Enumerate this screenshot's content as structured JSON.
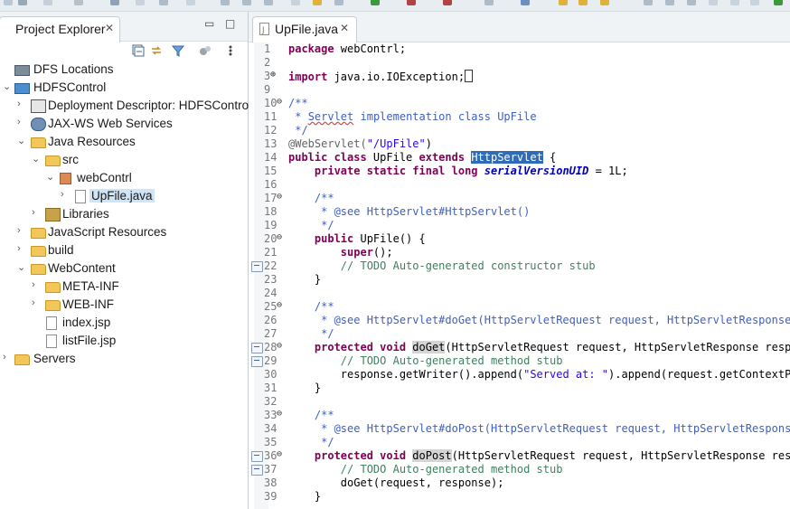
{
  "left_panel": {
    "tab_title": "Project Explorer",
    "tab_close": "✕",
    "minimize": "▭",
    "maximize": "□",
    "tree": [
      {
        "label": "DFS Locations",
        "icon": "dfs-locations-icon"
      },
      {
        "label": "HDFSControl",
        "icon": "project-icon",
        "twisty": "⌄"
      },
      {
        "label": "Deployment Descriptor: HDFSControl",
        "icon": "deployment-descriptor-icon",
        "twisty": "›"
      },
      {
        "label": "JAX-WS Web Services",
        "icon": "web-services-icon",
        "twisty": "›"
      },
      {
        "label": "Java Resources",
        "icon": "java-resources-icon",
        "twisty": "⌄"
      },
      {
        "label": "src",
        "icon": "source-folder-icon",
        "twisty": "⌄"
      },
      {
        "label": "webContrl",
        "icon": "package-icon",
        "twisty": "⌄"
      },
      {
        "label": "UpFile.java",
        "icon": "java-file-icon",
        "twisty": "›"
      },
      {
        "label": "Libraries",
        "icon": "libraries-icon",
        "twisty": "›"
      },
      {
        "label": "JavaScript Resources",
        "icon": "javascript-resources-icon",
        "twisty": "›"
      },
      {
        "label": "build",
        "icon": "folder-icon",
        "twisty": "›"
      },
      {
        "label": "WebContent",
        "icon": "folder-icon",
        "twisty": "⌄"
      },
      {
        "label": "META-INF",
        "icon": "folder-icon",
        "twisty": "›"
      },
      {
        "label": "WEB-INF",
        "icon": "folder-icon",
        "twisty": "›"
      },
      {
        "label": "index.jsp",
        "icon": "jsp-file-icon"
      },
      {
        "label": "listFile.jsp",
        "icon": "jsp-file-icon"
      },
      {
        "label": "Servers",
        "icon": "folder-icon",
        "twisty": "›"
      }
    ]
  },
  "editor": {
    "tab_title": "UpFile.java",
    "tab_close": "✕",
    "lines": [
      {
        "n": "1"
      },
      {
        "n": "2"
      },
      {
        "n": "3",
        "fold": "⊕"
      },
      {
        "n": "9"
      },
      {
        "n": "10",
        "fold": "⊖"
      },
      {
        "n": "11"
      },
      {
        "n": "12"
      },
      {
        "n": "13"
      },
      {
        "n": "14"
      },
      {
        "n": "15"
      },
      {
        "n": "16"
      },
      {
        "n": "17",
        "fold": "⊖"
      },
      {
        "n": "18"
      },
      {
        "n": "19"
      },
      {
        "n": "20",
        "fold": "⊖"
      },
      {
        "n": "21"
      },
      {
        "n": "22",
        "marker": true
      },
      {
        "n": "23"
      },
      {
        "n": "24"
      },
      {
        "n": "25",
        "fold": "⊖"
      },
      {
        "n": "26"
      },
      {
        "n": "27"
      },
      {
        "n": "28",
        "fold": "⊖",
        "marker": true
      },
      {
        "n": "29",
        "marker": true
      },
      {
        "n": "30"
      },
      {
        "n": "31"
      },
      {
        "n": "32"
      },
      {
        "n": "33",
        "fold": "⊖"
      },
      {
        "n": "34"
      },
      {
        "n": "35"
      },
      {
        "n": "36",
        "fold": "⊖",
        "marker": true
      },
      {
        "n": "37",
        "marker": true
      },
      {
        "n": "38"
      },
      {
        "n": "39"
      }
    ],
    "code": {
      "l1_kw": "package",
      "l1_rest": " webContrl;",
      "l3_kw": "import",
      "l3_rest": " java.io.IOException;",
      "l10": "/**",
      "l11_a": " * ",
      "l11_typo": "Servlet",
      "l11_b": " implementation class UpFile",
      "l12": " */",
      "l13_ann": "@WebServlet(",
      "l13_str": "\"/UpFile\"",
      "l13_end": ")",
      "l14_kw1": "public class",
      "l14_mid": " UpFile ",
      "l14_kw2": "extends",
      "l14_sp": " ",
      "l14_hl": "HttpServlet",
      "l14_end": " {",
      "l15_kw": "    private static final long",
      "l15_sp": " ",
      "l15_fld": "serialVersionUID",
      "l15_end": " = 1L;",
      "l17": "    /**",
      "l18": "     * @see HttpServlet#HttpServlet()",
      "l19": "     */",
      "l20_kw": "    public",
      "l20_rest": " UpFile() {",
      "l21_kw": "        super",
      "l21_rest": "();",
      "l22": "        // TODO Auto-generated constructor stub",
      "l23": "    }",
      "l25": "    /**",
      "l26": "     * @see HttpServlet#doGet(HttpServletRequest request, HttpServletResponse re",
      "l27": "     */",
      "l28_kw": "    protected void",
      "l28_sp": " ",
      "l28_occ": "doGet",
      "l28_rest": "(HttpServletRequest request, HttpServletResponse respons",
      "l29": "        // TODO Auto-generated method stub",
      "l30_a": "        response.getWriter().append(",
      "l30_str": "\"Served at: \"",
      "l30_b": ").append(request.getContextPath",
      "l31": "    }",
      "l33": "    /**",
      "l34": "     * @see HttpServlet#doPost(HttpServletRequest request, HttpServletResponse r",
      "l35": "     */",
      "l36_kw": "    protected void",
      "l36_sp": " ",
      "l36_occ": "doPost",
      "l36_rest": "(HttpServletRequest request, HttpServletResponse respon",
      "l37": "        // TODO Auto-generated method stub",
      "l38": "        doGet(request, response);",
      "l39": "    }"
    }
  },
  "colors": {
    "keyword": "#7f0055",
    "comment": "#3f7f5f",
    "javadoc": "#3f5fbf",
    "string": "#2a00ff",
    "field": "#0000c0",
    "selection": "#2f6bb7"
  }
}
